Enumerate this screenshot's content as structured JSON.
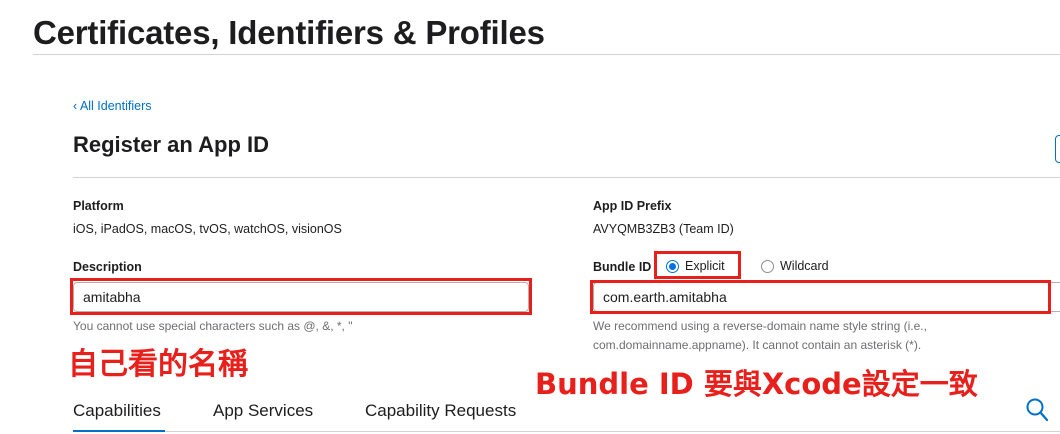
{
  "header": {
    "title": "Certificates, Identifiers & Profiles"
  },
  "nav": {
    "back_link": "‹ All Identifiers"
  },
  "section": {
    "title": "Register an App ID"
  },
  "platform": {
    "label": "Platform",
    "value": "iOS, iPadOS, macOS, tvOS, watchOS, visionOS"
  },
  "app_id_prefix": {
    "label": "App ID Prefix",
    "value": "AVYQMB3ZB3 (Team ID)"
  },
  "description": {
    "label": "Description",
    "value": "amitabha",
    "hint": "You cannot use special characters such as @, &, *, \""
  },
  "bundle_id": {
    "label": "Bundle ID",
    "options": [
      {
        "label": "Explicit",
        "selected": true
      },
      {
        "label": "Wildcard",
        "selected": false
      }
    ],
    "value": "com.earth.amitabha",
    "hint_line1": "We recommend using a reverse-domain name style string (i.e.,",
    "hint_line2": "com.domainname.appname). It cannot contain an asterisk (*)."
  },
  "annotations": {
    "description_note": "自己看的名稱",
    "bundle_note": "Bundle ID 要與Xcode設定一致",
    "color": "#e8201c"
  },
  "tabs": [
    {
      "label": "Capabilities",
      "active": true
    },
    {
      "label": "App Services",
      "active": false
    },
    {
      "label": "Capability Requests",
      "active": false
    }
  ],
  "colors": {
    "accent": "#0070c9",
    "annotation": "#e8201c"
  }
}
